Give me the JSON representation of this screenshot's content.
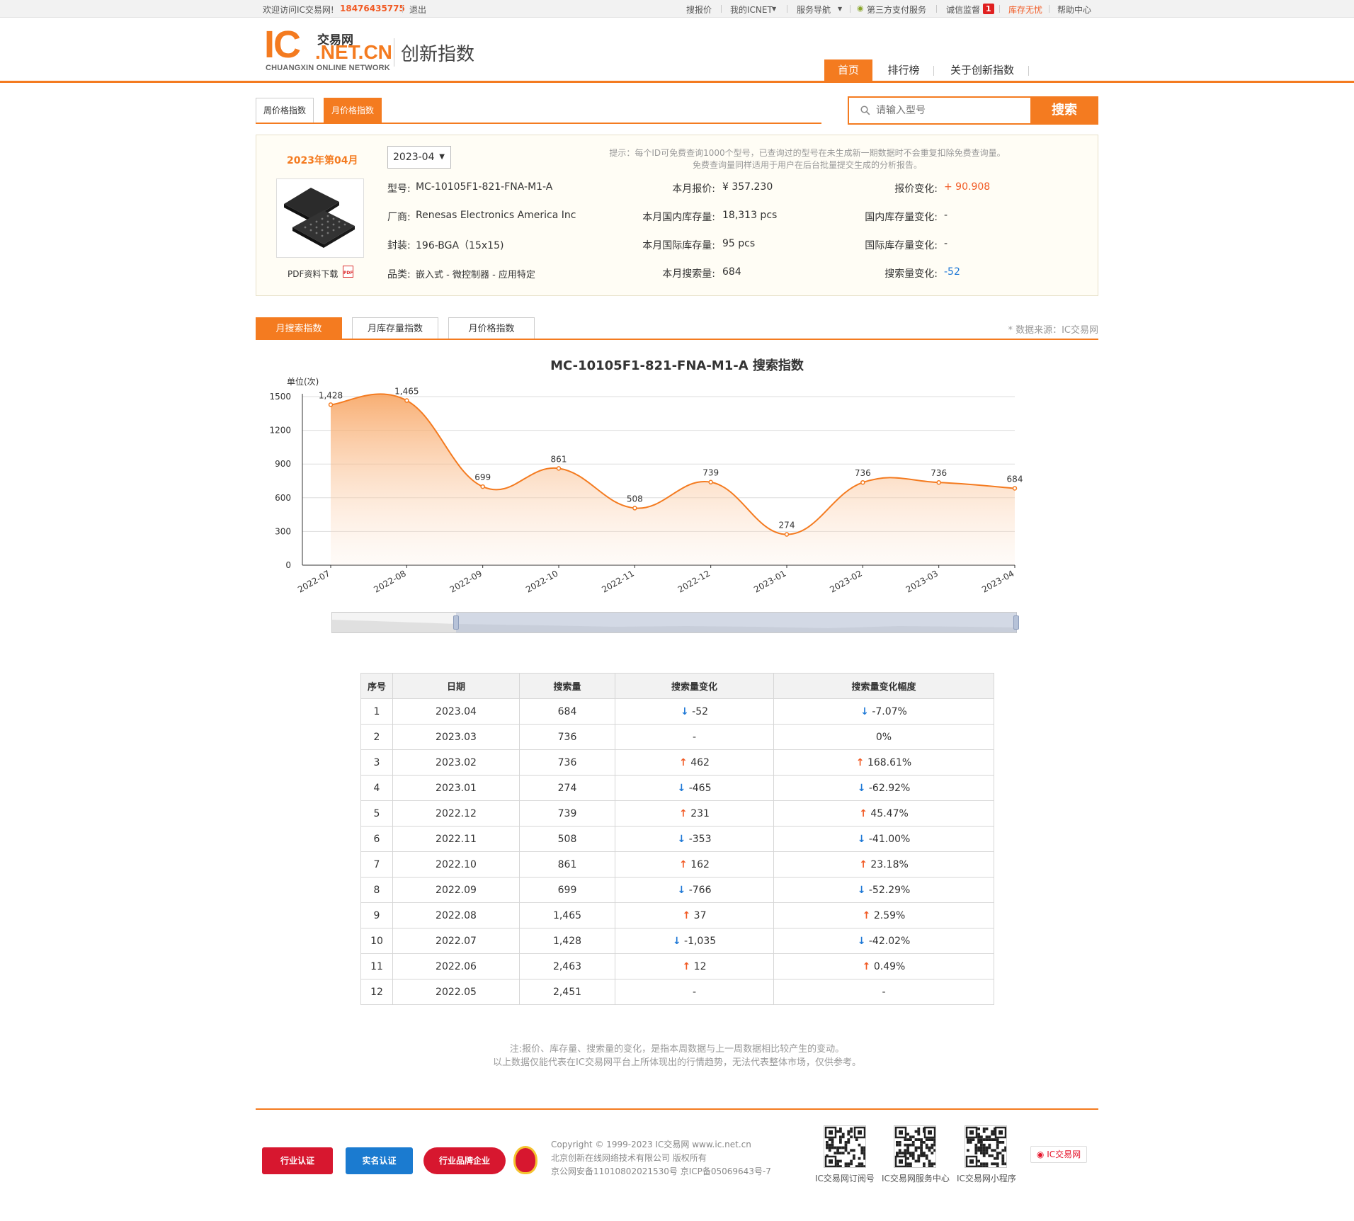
{
  "topbar": {
    "welcome": "欢迎访问IC交易网!",
    "phone": "18476435775",
    "logout": "退出",
    "links": [
      "搜报价",
      "我的ICNET",
      "服务导航",
      "第三方支付服务",
      "诚信监督",
      "库存无忧",
      "帮助中心"
    ],
    "badge": "1"
  },
  "header": {
    "logo_ic": "IC",
    "logo_cn": "交易网",
    "logo_net": ".NET.CN",
    "logo_sub": "CHUANGXIN ONLINE NETWORK",
    "site_title": "创新指数",
    "nav": [
      "首页",
      "排行榜",
      "关于创新指数"
    ]
  },
  "subtabs": [
    "周价格指数",
    "月价格指数"
  ],
  "search": {
    "placeholder": "请输入型号",
    "button": "搜索"
  },
  "info": {
    "period_label": "2023年第04月",
    "period_select": "2023-04",
    "hint_line1": "提示：每个ID可免费查询1000个型号，已查询过的型号在未生成新一期数据时不会重复扣除免费查询量。",
    "hint_line2": "免费查询量同样适用于用户在后台批量提交生成的分析报告。",
    "pdf_label": "PDF资料下载",
    "model_label": "型号:",
    "model": "MC-10105F1-821-FNA-M1-A",
    "maker_label": "厂商:",
    "maker": "Renesas Electronics America Inc",
    "package_label": "封装:",
    "package": "196-BGA（15x15)",
    "category_label": "品类:",
    "category": "嵌入式 - 微控制器 - 应用特定",
    "price_label": "本月报价:",
    "price": "¥ 357.230",
    "dom_stock_label": "本月国内库存量:",
    "dom_stock": "18,313  pcs",
    "intl_stock_label": "本月国际库存量:",
    "intl_stock": "95  pcs",
    "search_label": "本月搜索量:",
    "search": "684",
    "price_chg_label": "报价变化:",
    "price_chg": "+ 90.908",
    "dom_chg_label": "国内库存量变化:",
    "dom_chg": "-",
    "intl_chg_label": "国际库存量变化:",
    "intl_chg": "-",
    "search_chg_label": "搜索量变化:",
    "search_chg": "-52"
  },
  "chart_tabs": [
    "月搜索指数",
    "月库存量指数",
    "月价格指数"
  ],
  "source": "* 数据来源：IC交易网",
  "colors": {
    "accent": "#f47b20",
    "up": "#f15a24",
    "down": "#1e78d6"
  },
  "chart_data": {
    "type": "area",
    "title": "MC-10105F1-821-FNA-M1-A 搜索指数",
    "ylabel": "单位(次)",
    "categories": [
      "2022-07",
      "2022-08",
      "2022-09",
      "2022-10",
      "2022-11",
      "2022-12",
      "2023-01",
      "2023-02",
      "2023-03",
      "2023-04"
    ],
    "values": [
      1428,
      1465,
      699,
      861,
      508,
      739,
      274,
      736,
      736,
      684
    ],
    "value_labels": [
      "1,428",
      "1,465",
      "699",
      "861",
      "508",
      "739",
      "274",
      "736",
      "736",
      "684"
    ],
    "yticks": [
      "0",
      "300",
      "600",
      "900",
      "1200",
      "1500"
    ],
    "ylim": [
      0,
      1500
    ],
    "grid": true,
    "dataZoom": true
  },
  "table": {
    "headers": [
      "序号",
      "日期",
      "搜索量",
      "搜索量变化",
      "搜索量变化幅度"
    ],
    "rows": [
      {
        "no": "1",
        "date": "2023.04",
        "vol": "684",
        "chg": "-52",
        "pct": "-7.07%",
        "dir": "dn"
      },
      {
        "no": "2",
        "date": "2023.03",
        "vol": "736",
        "chg": "-",
        "pct": "0%",
        "dir": ""
      },
      {
        "no": "3",
        "date": "2023.02",
        "vol": "736",
        "chg": "462",
        "pct": "168.61%",
        "dir": "up"
      },
      {
        "no": "4",
        "date": "2023.01",
        "vol": "274",
        "chg": "-465",
        "pct": "-62.92%",
        "dir": "dn"
      },
      {
        "no": "5",
        "date": "2022.12",
        "vol": "739",
        "chg": "231",
        "pct": "45.47%",
        "dir": "up"
      },
      {
        "no": "6",
        "date": "2022.11",
        "vol": "508",
        "chg": "-353",
        "pct": "-41.00%",
        "dir": "dn"
      },
      {
        "no": "7",
        "date": "2022.10",
        "vol": "861",
        "chg": "162",
        "pct": "23.18%",
        "dir": "up"
      },
      {
        "no": "8",
        "date": "2022.09",
        "vol": "699",
        "chg": "-766",
        "pct": "-52.29%",
        "dir": "dn"
      },
      {
        "no": "9",
        "date": "2022.08",
        "vol": "1,465",
        "chg": "37",
        "pct": "2.59%",
        "dir": "up"
      },
      {
        "no": "10",
        "date": "2022.07",
        "vol": "1,428",
        "chg": "-1,035",
        "pct": "-42.02%",
        "dir": "dn"
      },
      {
        "no": "11",
        "date": "2022.06",
        "vol": "2,463",
        "chg": "12",
        "pct": "0.49%",
        "dir": "up"
      },
      {
        "no": "12",
        "date": "2022.05",
        "vol": "2,451",
        "chg": "-",
        "pct": "-",
        "dir": ""
      }
    ]
  },
  "note_line1": "注:报价、库存量、搜索量的变化，是指本周数据与上一周数据相比较产生的变动。",
  "note_line2": "以上数据仅能代表在IC交易网平台上所体现出的行情趋势，无法代表整体市场，仅供参考。",
  "footer": {
    "badges": [
      "行业认证",
      "实名认证",
      "行业品牌企业"
    ],
    "copyright1": "Copyright © 1999-2023 IC交易网 www.ic.net.cn",
    "copyright2": "北京创新在线网络技术有限公司 版权所有",
    "copyright3": "京公网安备11010802021530号    京ICP备05069643号-7",
    "qr_labels": [
      "IC交易网订阅号",
      "IC交易网服务中心",
      "IC交易网小程序"
    ],
    "weibo": "IC交易网"
  }
}
